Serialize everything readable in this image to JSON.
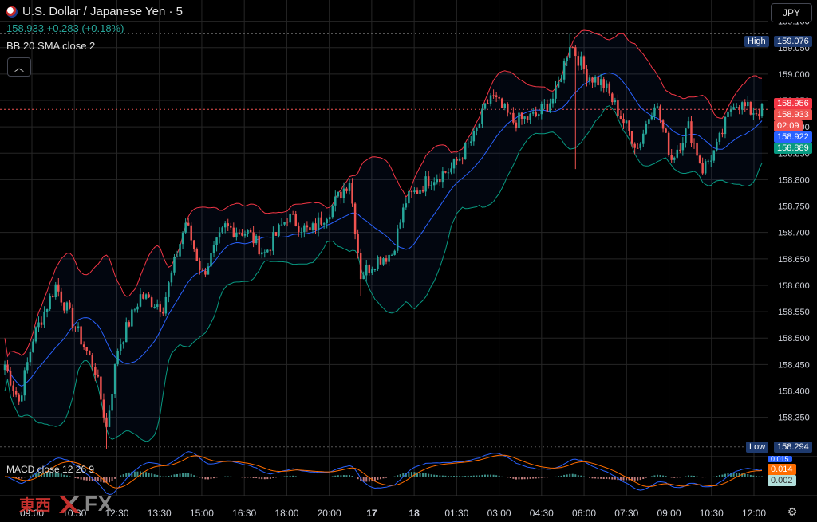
{
  "header": {
    "symbol_title": "U.S. Dollar / Japanese Yen · 5",
    "quote": "158.933 +0.283 (+0.18%)",
    "indicator": "BB 20 SMA close 2"
  },
  "currency_button": "JPY",
  "price_axis": {
    "ticks": [
      "159.100",
      "159.050",
      "159.000",
      "158.950",
      "158.900",
      "158.850",
      "158.800",
      "158.750",
      "158.700",
      "158.650",
      "158.600",
      "158.550",
      "158.500",
      "158.450",
      "158.400",
      "158.350"
    ],
    "high_label": "High",
    "high_value": "159.076",
    "low_label": "Low",
    "low_value": "158.294",
    "bb_upper_value": "158.956",
    "last_price": "158.933",
    "countdown": "02:09",
    "bb_basis_value": "158.922",
    "bb_lower_value": "158.889"
  },
  "time_axis": {
    "labels": [
      "09:00",
      "10:30",
      "12:30",
      "13:30",
      "15:00",
      "16:30",
      "18:00",
      "20:00",
      "17",
      "18",
      "01:30",
      "03:00",
      "04:30",
      "06:00",
      "07:30",
      "09:00",
      "10:30",
      "12:00"
    ]
  },
  "macd": {
    "label": "MACD close 12 26 9",
    "values": [
      "0.015",
      "0.014",
      "0.002"
    ]
  },
  "logo": {
    "cn": "東西",
    "fx": "FX"
  },
  "colors": {
    "up": "#26a69a",
    "down": "#ef5350",
    "bb_upper": "#f23645",
    "bb_basis": "#2962ff",
    "bb_lower": "#089981",
    "grid": "#262626",
    "macd_line": "#2962ff",
    "signal_line": "#ff6d00"
  },
  "icons": {
    "collapse": "chevron-up-icon",
    "settings": "gear-icon"
  },
  "chart_data": {
    "type": "candlestick",
    "ylim": [
      158.28,
      159.11
    ],
    "key_points": [
      {
        "i": 0,
        "p": 158.45
      },
      {
        "i": 5,
        "p": 158.38
      },
      {
        "i": 10,
        "p": 158.5
      },
      {
        "i": 18,
        "p": 158.6
      },
      {
        "i": 25,
        "p": 158.52
      },
      {
        "i": 32,
        "p": 158.44
      },
      {
        "i": 36,
        "p": 158.33
      },
      {
        "i": 40,
        "p": 158.48
      },
      {
        "i": 48,
        "p": 158.58
      },
      {
        "i": 56,
        "p": 158.56
      },
      {
        "i": 64,
        "p": 158.72
      },
      {
        "i": 70,
        "p": 158.62
      },
      {
        "i": 78,
        "p": 158.71
      },
      {
        "i": 86,
        "p": 158.7
      },
      {
        "i": 92,
        "p": 158.66
      },
      {
        "i": 100,
        "p": 158.73
      },
      {
        "i": 108,
        "p": 158.7
      },
      {
        "i": 116,
        "p": 158.75
      },
      {
        "i": 122,
        "p": 158.8
      },
      {
        "i": 126,
        "p": 158.62
      },
      {
        "i": 132,
        "p": 158.65
      },
      {
        "i": 137,
        "p": 158.66
      },
      {
        "i": 142,
        "p": 158.76
      },
      {
        "i": 150,
        "p": 158.8
      },
      {
        "i": 158,
        "p": 158.82
      },
      {
        "i": 166,
        "p": 158.88
      },
      {
        "i": 172,
        "p": 158.96
      },
      {
        "i": 180,
        "p": 158.91
      },
      {
        "i": 188,
        "p": 158.92
      },
      {
        "i": 195,
        "p": 158.96
      },
      {
        "i": 200,
        "p": 159.06
      },
      {
        "i": 206,
        "p": 159.0
      },
      {
        "i": 212,
        "p": 158.98
      },
      {
        "i": 218,
        "p": 158.92
      },
      {
        "i": 224,
        "p": 158.86
      },
      {
        "i": 230,
        "p": 158.95
      },
      {
        "i": 236,
        "p": 158.84
      },
      {
        "i": 242,
        "p": 158.9
      },
      {
        "i": 247,
        "p": 158.82
      },
      {
        "i": 252,
        "p": 158.86
      },
      {
        "i": 258,
        "p": 158.95
      },
      {
        "i": 264,
        "p": 158.93
      },
      {
        "i": 268,
        "p": 158.93
      }
    ]
  }
}
